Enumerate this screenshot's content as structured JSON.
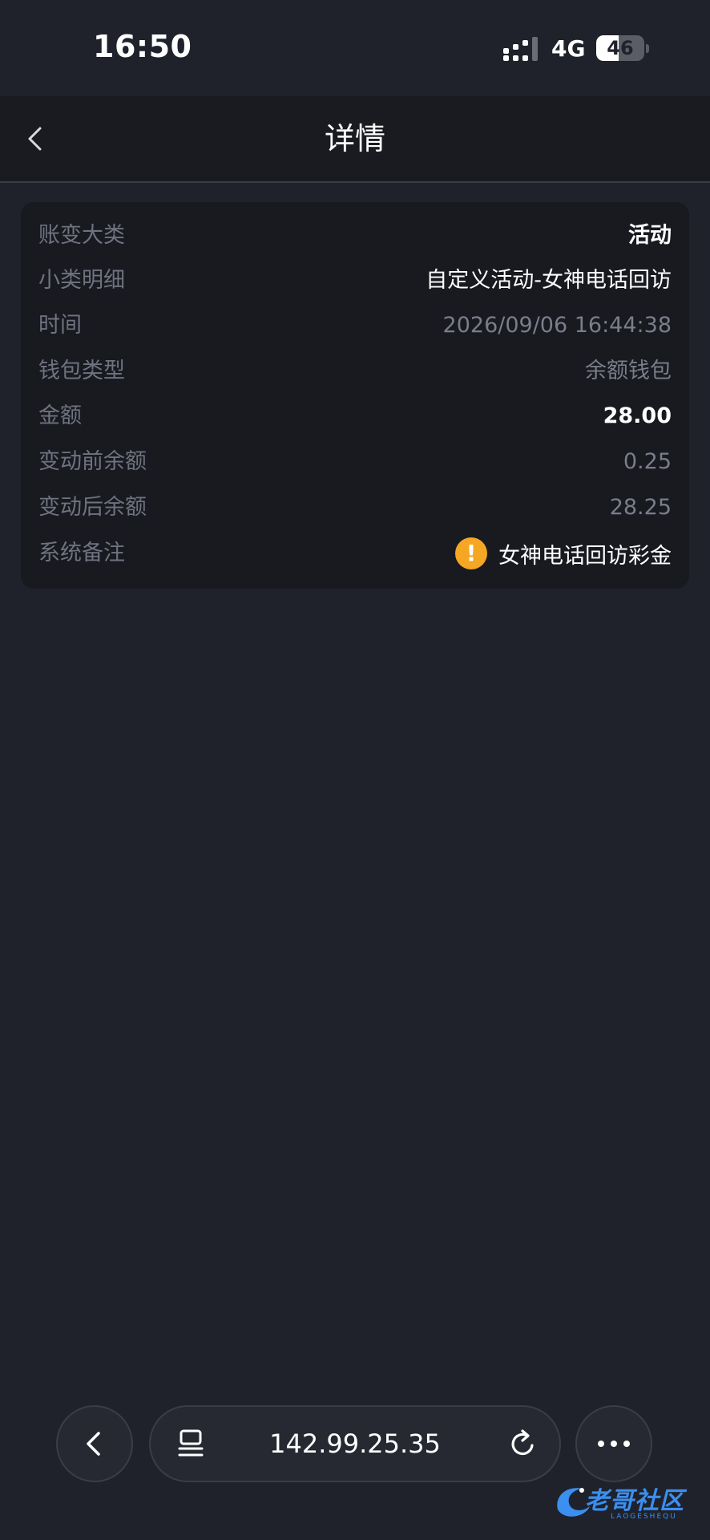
{
  "status_bar": {
    "time": "16:50",
    "network": "4G",
    "battery_level": "46",
    "battery_percent": 46
  },
  "header": {
    "title": "详情",
    "back_icon": "chevron-left-icon"
  },
  "detail": {
    "rows": [
      {
        "label": "账变大类",
        "value": "活动"
      },
      {
        "label": "小类明细",
        "value": "自定义活动-女神电话回访"
      },
      {
        "label": "时间",
        "value": "2026/09/06 16:44:38"
      },
      {
        "label": "钱包类型",
        "value": "余额钱包"
      },
      {
        "label": "金额",
        "value": "28.00"
      },
      {
        "label": "变动前余额",
        "value": "0.25"
      },
      {
        "label": "变动后余额",
        "value": "28.25"
      },
      {
        "label": "系统备注",
        "value": "女神电话回访彩金",
        "icon": "warning-icon",
        "icon_glyph": "!"
      }
    ]
  },
  "browser_bar": {
    "back_icon": "chevron-left-icon",
    "tabs_icon": "tabs-icon",
    "url": "142.99.25.35",
    "reload_icon": "reload-icon",
    "more_icon": "more-icon"
  },
  "watermark": {
    "text": "老哥社区",
    "subtext": "LAOGESHEQU"
  },
  "colors": {
    "background": "#1f222b",
    "card": "#181a20",
    "accent_warning": "#f5a623",
    "watermark": "#3b8ff0"
  }
}
